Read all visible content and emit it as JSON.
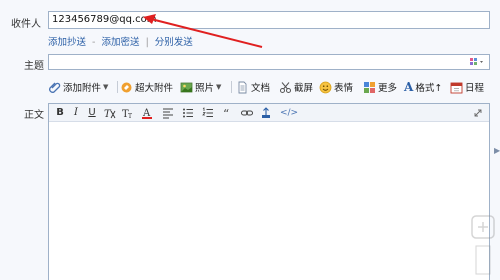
{
  "recipient": {
    "label": "收件人",
    "value": "123456789@qq.com"
  },
  "recipient_links": {
    "add_cc": "添加抄送",
    "separator_dash": "-",
    "add_bcc": "添加密送",
    "separator_bar": "|",
    "send_separately": "分别发送"
  },
  "subject": {
    "label": "主题",
    "value": ""
  },
  "toolbar": {
    "add_attachment": "添加附件",
    "large_attachment": "超大附件",
    "photo": "照片",
    "document": "文档",
    "screenshot": "截屏",
    "emoji": "表情",
    "more": "更多",
    "format": "格式↑",
    "calendar": "日程"
  },
  "body": {
    "label": "正文"
  },
  "editor_toolbar": {
    "bold": "B",
    "italic": "I",
    "underline": "U",
    "html_source": "</>"
  },
  "colors": {
    "link": "#2b5fa6",
    "border": "#9fb1c8",
    "arrow": "#e02020",
    "background": "#f6f8fc"
  }
}
